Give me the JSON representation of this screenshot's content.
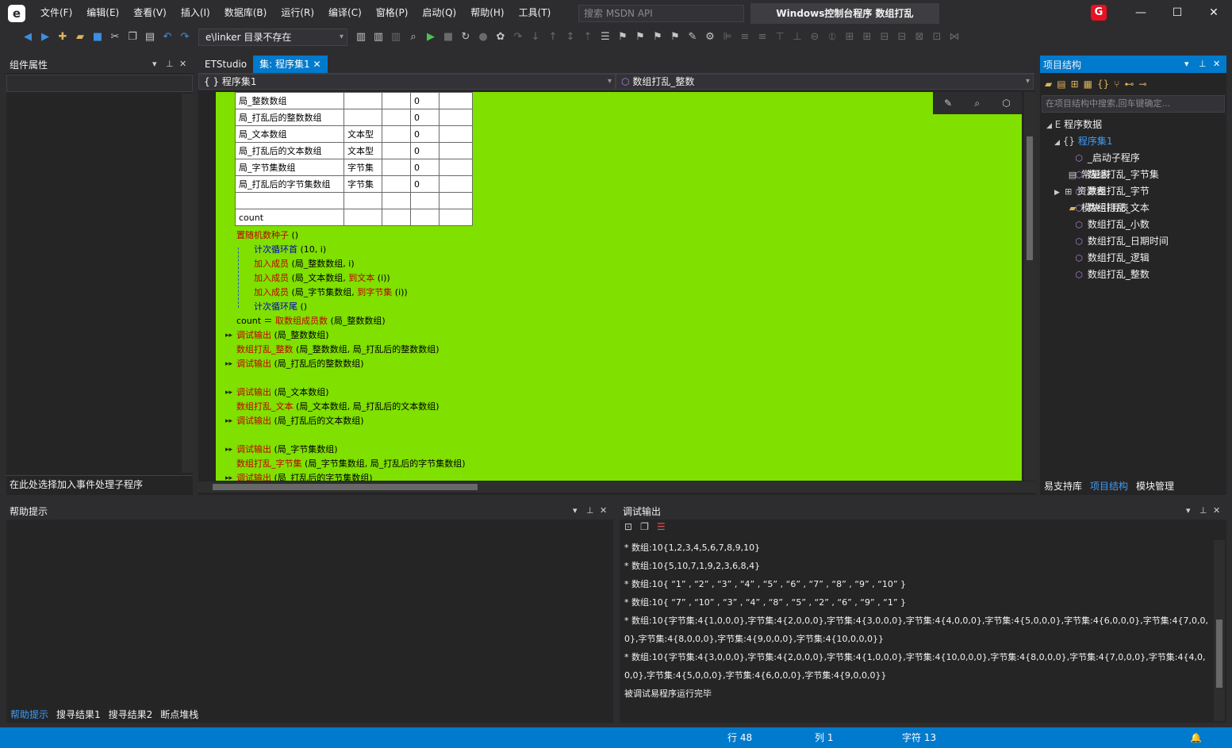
{
  "titlebar": {
    "menus": [
      "文件(F)",
      "编辑(E)",
      "查看(V)",
      "插入(I)",
      "数据库(B)",
      "运行(R)",
      "编译(C)",
      "窗格(P)",
      "启动(Q)",
      "帮助(H)",
      "工具(T)"
    ],
    "search_placeholder": "搜索 MSDN API",
    "title": "Windows控制台程序  数组打乱"
  },
  "toolbar": {
    "path_combo": "e\\linker 目录不存在"
  },
  "left_panel": {
    "title": "组件属性",
    "event_combo": "在此处选择加入事件处理子程序"
  },
  "editor": {
    "tabs": [
      "ETStudio",
      "集: 程序集1"
    ],
    "nav_left": "程序集1",
    "nav_right": "数组打乱_整数",
    "var_table": [
      {
        "name": "局_整数数组",
        "type": "",
        "v": "0"
      },
      {
        "name": "局_打乱后的整数数组",
        "type": "",
        "v": "0"
      },
      {
        "name": "局_文本数组",
        "type": "文本型",
        "v": "0"
      },
      {
        "name": "局_打乱后的文本数组",
        "type": "文本型",
        "v": "0"
      },
      {
        "name": "局_字节集数组",
        "type": "字节集",
        "v": "0"
      },
      {
        "name": "局_打乱后的字节集数组",
        "type": "字节集",
        "v": "0"
      },
      {
        "name": "",
        "type": "",
        "v": ""
      },
      {
        "name": "count",
        "type": "",
        "v": ""
      }
    ],
    "lines": [
      {
        "kw": "置随机数种子",
        "rest": " ()"
      },
      {
        "kw": "计次循环首",
        "rest": " (10, i)"
      },
      {
        "kw": "加入成员",
        "rest": " (局_整数数组, i)"
      },
      {
        "kw": "加入成员",
        "rest": " (局_文本数组, ",
        "kw2": "到文本",
        "rest2": " (i))"
      },
      {
        "kw": "加入成员",
        "rest": " (局_字节集数组, ",
        "kw2": "到字节集",
        "rest2": " (i))"
      },
      {
        "kw": "计次循环尾",
        "rest": " ()"
      },
      {
        "pre": "count ＝ ",
        "kw": "取数组成员数",
        "rest": " (局_整数数组)"
      },
      {
        "kw": "调试输出",
        "rest": " (局_整数数组)"
      },
      {
        "kw": "数组打乱_整数",
        "rest": " (局_整数数组, 局_打乱后的整数数组)"
      },
      {
        "kw": "调试输出",
        "rest": " (局_打乱后的整数数组)"
      },
      {
        "kw": "调试输出",
        "rest": " (局_文本数组)"
      },
      {
        "kw": "数组打乱_文本",
        "rest": " (局_文本数组, 局_打乱后的文本数组)"
      },
      {
        "kw": "调试输出",
        "rest": " (局_打乱后的文本数组)"
      },
      {
        "kw": "调试输出",
        "rest": " (局_字节集数组)"
      },
      {
        "kw": "数组打乱_字节集",
        "rest": " (局_字节集数组, 局_打乱后的字节集数组)"
      },
      {
        "kw": "调试输出",
        "rest": " (局_打乱后的字节集数组)"
      }
    ]
  },
  "right_panel": {
    "title": "项目结构",
    "search_placeholder": "在项目结构中搜索,回车键确定...",
    "tree": {
      "root": "程序数据",
      "assembly": "程序集1",
      "subs": [
        "_启动子程序",
        "数组打乱_字节集",
        "数组打乱_字节",
        "数组打乱_文本",
        "数组打乱_小数",
        "数组打乱_日期时间",
        "数组打乱_逻辑",
        "数组打乱_整数"
      ],
      "const": "常量表",
      "res": "资源表",
      "mod": "模块引用表"
    },
    "bottom_tabs": [
      "易支持库",
      "项目结构",
      "模块管理"
    ]
  },
  "help_panel": {
    "title": "帮助提示",
    "bottom_tabs": [
      "帮助提示",
      "搜寻结果1",
      "搜寻结果2",
      "断点堆栈"
    ]
  },
  "debug_panel": {
    "title": "调试输出",
    "lines": [
      "* 数组:10{1,2,3,4,5,6,7,8,9,10}",
      "* 数组:10{5,10,7,1,9,2,3,6,8,4}",
      "* 数组:10{ “1” , “2” , “3” , “4” , “5” , “6” , “7” , “8” , “9” , “10” }",
      "* 数组:10{ “7” , “10” , “3” , “4” , “8” , “5” , “2” , “6” , “9” , “1” }",
      "* 数组:10{字节集:4{1,0,0,0},字节集:4{2,0,0,0},字节集:4{3,0,0,0},字节集:4{4,0,0,0},字节集:4{5,0,0,0},字节集:4{6,0,0,0},字节集:4{7,0,0,0},字节集:4{8,0,0,0},字节集:4{9,0,0,0},字节集:4{10,0,0,0}}",
      "* 数组:10{字节集:4{3,0,0,0},字节集:4{2,0,0,0},字节集:4{1,0,0,0},字节集:4{10,0,0,0},字节集:4{8,0,0,0},字节集:4{7,0,0,0},字节集:4{4,0,0,0},字节集:4{5,0,0,0},字节集:4{6,0,0,0},字节集:4{9,0,0,0}}",
      "被调试易程序运行完毕"
    ]
  },
  "statusbar": {
    "row": "行 48",
    "col": "列 1",
    "chars": "字符 13"
  },
  "colors": {
    "accent": "#007acc",
    "code_bg": "#80e000",
    "keyword": "#c00000",
    "type": "#0000c0"
  }
}
